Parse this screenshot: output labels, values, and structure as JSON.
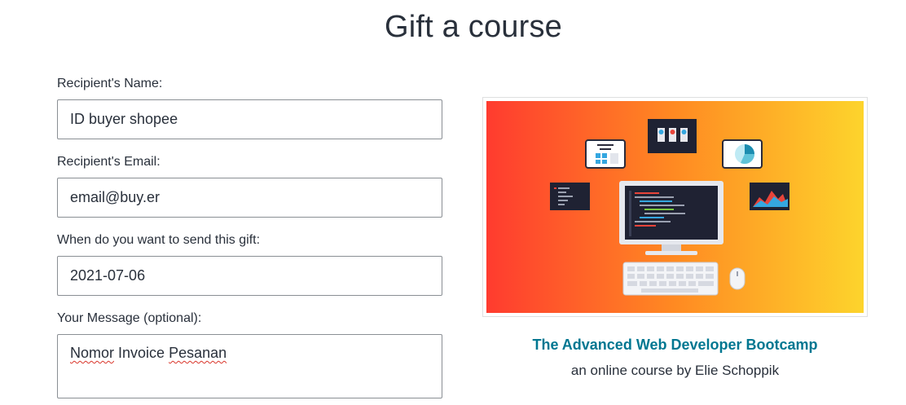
{
  "page": {
    "title": "Gift a course"
  },
  "form": {
    "recipient_name": {
      "label": "Recipient's Name:",
      "value": "ID buyer shopee"
    },
    "recipient_email": {
      "label": "Recipient's Email:",
      "value": "email@buy.er"
    },
    "send_date": {
      "label": "When do you want to send this gift:",
      "value": "2021-07-06"
    },
    "message": {
      "label": "Your Message (optional):",
      "words": [
        "Nomor",
        "Invoice",
        "Pesanan"
      ]
    }
  },
  "course": {
    "title": "The Advanced Web Developer Bootcamp",
    "author_line": "an online course by Elie Schoppik"
  },
  "colors": {
    "text": "#29303b",
    "link": "#007791",
    "gradient_start": "#ff3b2f",
    "gradient_end": "#fdd42c"
  }
}
